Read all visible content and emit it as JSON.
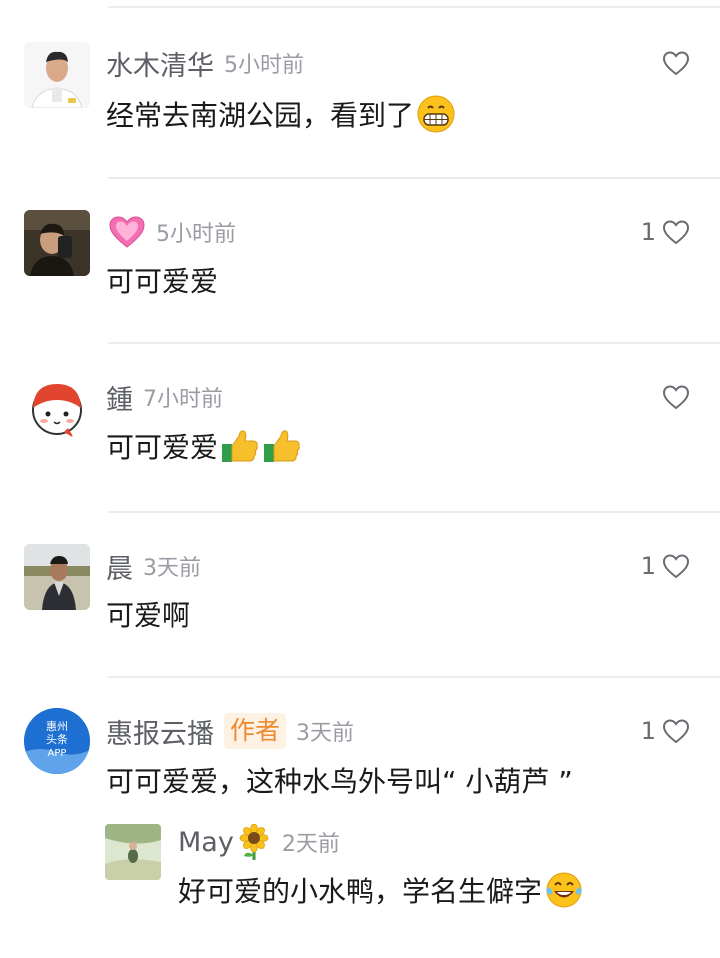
{
  "comments": [
    {
      "name": "水木清华",
      "time": "5小时前",
      "text": "经常去南湖公园，看到了",
      "likes": ""
    },
    {
      "name": "",
      "time": "5小时前",
      "text": "可可爱爱",
      "likes": "1"
    },
    {
      "name": "鍾",
      "time": "7小时前",
      "text": "可可爱爱",
      "likes": ""
    },
    {
      "name": "晨",
      "time": "3天前",
      "text": "可爱啊",
      "likes": "1"
    },
    {
      "name": "惠报云播",
      "badge": "作者",
      "time": "3天前",
      "text": "可可爱爱，这种水鸟外号叫“ 小葫芦 ”",
      "likes": "1",
      "avatar_text": [
        "惠州",
        "头条",
        "APP"
      ]
    }
  ],
  "reply": {
    "name": "May",
    "time": "2天前",
    "text": "好可爱的小水鸭，学名生僻字"
  },
  "icons": [
    "heart-outline-icon",
    "grin-emoji-icon",
    "pink-heart-emoji-icon",
    "thumbs-up-emoji-icon",
    "sunflower-emoji-icon",
    "laugh-tears-emoji-icon"
  ],
  "colors": {
    "name": "#5c5f66",
    "time": "#9a9ca3",
    "author_badge": "#ef8a2e",
    "separator": "#ececec"
  }
}
